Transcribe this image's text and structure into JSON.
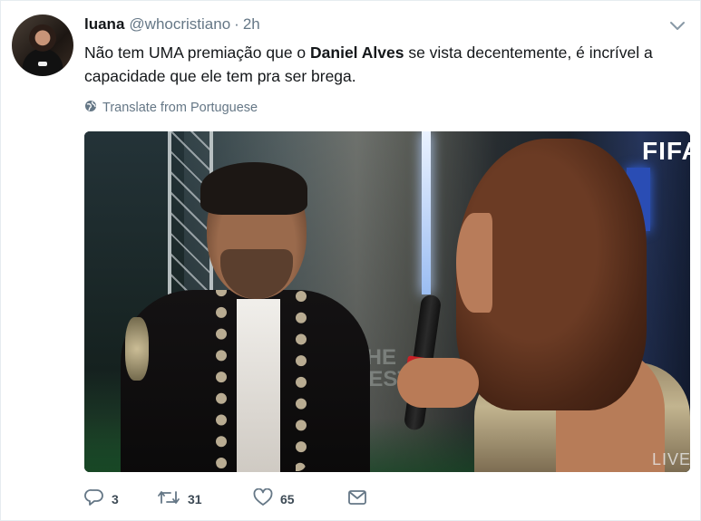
{
  "tweet": {
    "author_name": "luana",
    "author_handle": "@whocristiano",
    "separator": "·",
    "time": "2h",
    "text_before": "Não tem UMA premiação que o ",
    "text_bold": "Daniel Alves",
    "text_after": " se vista decentemente, é incrível a capacidade que ele tem pra ser brega.",
    "translate_label": "Translate from Portuguese"
  },
  "media": {
    "broadcaster_logo": "FIFA",
    "corner_text": "LIVE",
    "background_text": "THE\nBEST"
  },
  "actions": {
    "reply_count": "3",
    "retweet_count": "31",
    "like_count": "65"
  },
  "icons": {
    "caret": "chevron-down-icon",
    "translate": "globe-icon",
    "reply": "reply-icon",
    "retweet": "retweet-icon",
    "like": "heart-icon",
    "dm": "envelope-icon"
  },
  "colors": {
    "text_primary": "#14171a",
    "text_secondary": "#657786",
    "border": "#e6ecf0"
  }
}
